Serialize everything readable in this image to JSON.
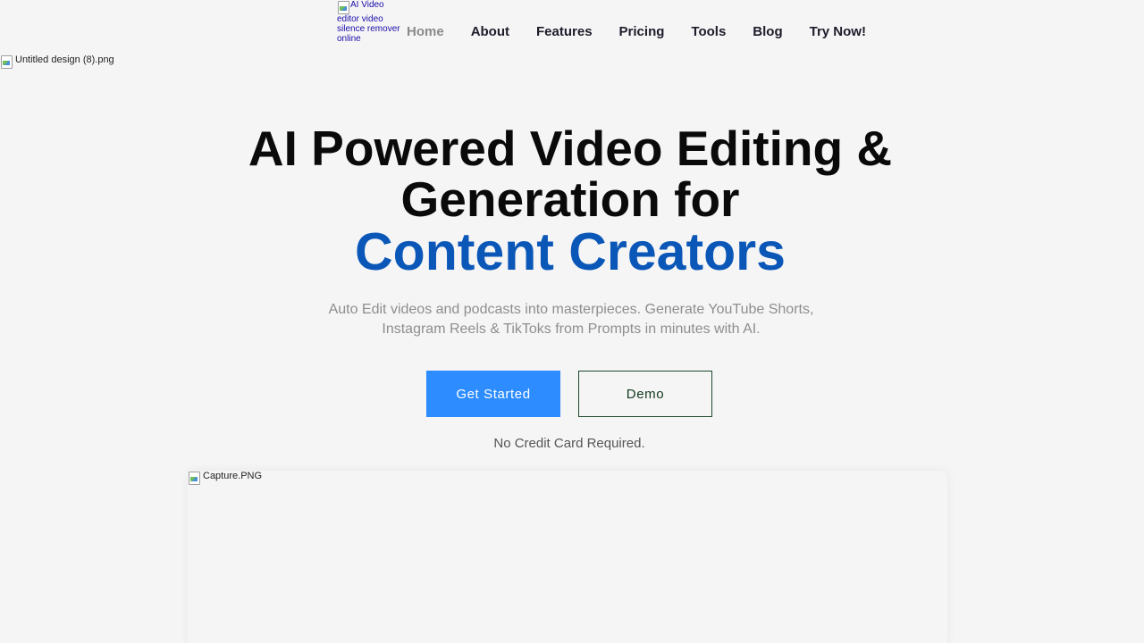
{
  "header": {
    "logo_alt": "AI Video editor video silence remover online",
    "nav": [
      {
        "label": "Home",
        "active": true
      },
      {
        "label": "About"
      },
      {
        "label": "Features"
      },
      {
        "label": "Pricing"
      },
      {
        "label": "Tools"
      },
      {
        "label": "Blog"
      },
      {
        "label": "Try Now!"
      }
    ]
  },
  "banner": {
    "alt": "Untitled design (8).png"
  },
  "hero": {
    "title_line1": "AI Powered Video Editing &",
    "title_line2": "Generation for",
    "title_accent": "Content Creators",
    "subtitle": "Auto Edit videos and podcasts into masterpieces. Generate YouTube Shorts, Instagram Reels & TikToks from Prompts in minutes with AI.",
    "primary_button": "Get Started",
    "secondary_button": "Demo",
    "note": "No Credit Card Required."
  },
  "preview": {
    "alt": "Capture.PNG"
  },
  "colors": {
    "accent": "#0b57b8",
    "primary_button": "#2d8cff",
    "background": "#f5f5f5",
    "demo_border": "#1f4a2e"
  }
}
